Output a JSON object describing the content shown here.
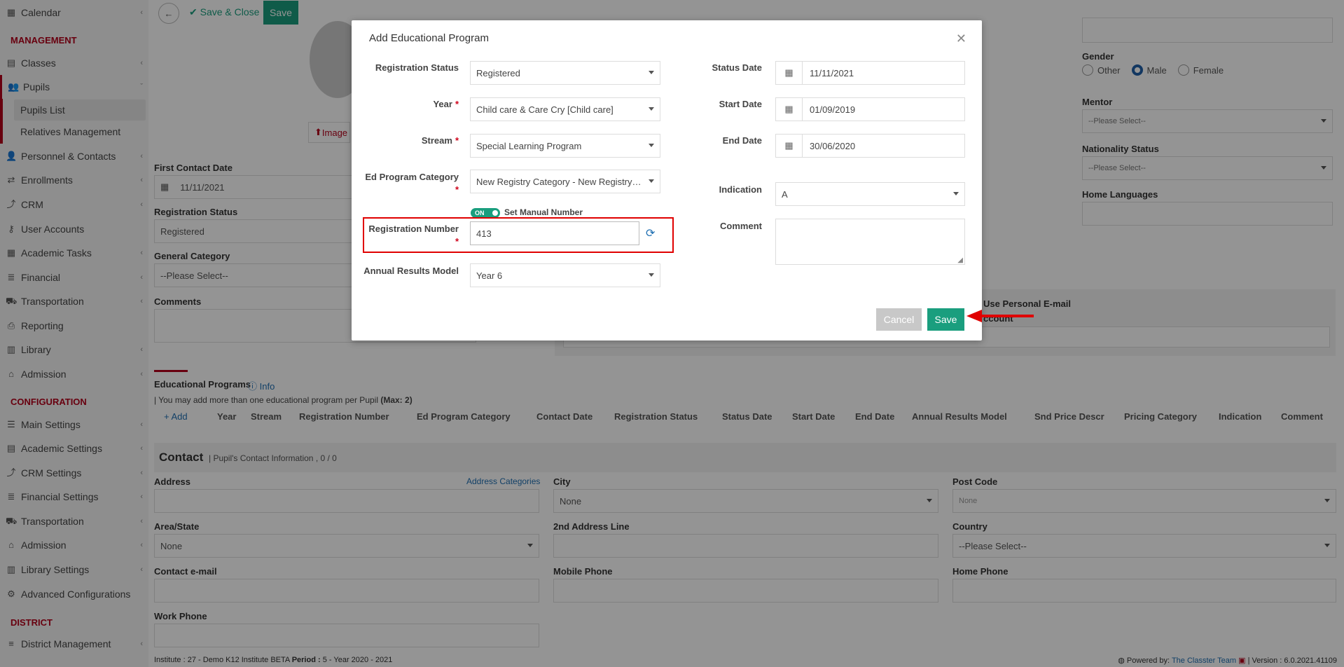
{
  "sidebar": {
    "items": [
      {
        "label": "Calendar",
        "icon": "calendar-icon"
      },
      {
        "label": "Classes",
        "icon": "classes-icon"
      },
      {
        "label": "Pupils",
        "icon": "pupils-icon"
      },
      {
        "label": "Personnel & Contacts",
        "icon": "personnel-icon"
      },
      {
        "label": "Enrollments",
        "icon": "enrollments-icon"
      },
      {
        "label": "CRM",
        "icon": "crm-icon"
      },
      {
        "label": "User Accounts",
        "icon": "key-icon"
      },
      {
        "label": "Academic Tasks",
        "icon": "tasks-icon"
      },
      {
        "label": "Financial",
        "icon": "financial-icon"
      },
      {
        "label": "Transportation",
        "icon": "bus-icon"
      },
      {
        "label": "Reporting",
        "icon": "print-icon"
      },
      {
        "label": "Library",
        "icon": "library-icon"
      },
      {
        "label": "Admission",
        "icon": "admission-icon"
      },
      {
        "label": "Main Settings",
        "icon": "sliders-icon"
      },
      {
        "label": "Academic Settings",
        "icon": "classes-icon"
      },
      {
        "label": "CRM Settings",
        "icon": "crm-icon"
      },
      {
        "label": "Financial Settings",
        "icon": "financial-icon"
      },
      {
        "label": "Transportation",
        "icon": "bus-icon"
      },
      {
        "label": "Admission",
        "icon": "admission-icon"
      },
      {
        "label": "Library Settings",
        "icon": "library-icon"
      },
      {
        "label": "Advanced Configurations",
        "icon": "gears-icon"
      },
      {
        "label": "District Management",
        "icon": "menu-icon"
      }
    ],
    "sections": {
      "management": "MANAGEMENT",
      "configuration": "CONFIGURATION",
      "district": "DISTRICT"
    },
    "subitems": {
      "pupils_list": "Pupils List",
      "relatives": "Relatives Management"
    }
  },
  "toolbar": {
    "save_close": "Save & Close",
    "save": "Save"
  },
  "form": {
    "image_btn": "Image",
    "first_contact_label": "First Contact Date",
    "first_contact_value": "11/11/2021",
    "reg_status_label": "Registration Status",
    "reg_status_value": "Registered",
    "general_category_label": "General Category",
    "general_category_value": "--Please Select--",
    "comments_label": "Comments",
    "gender_label": "Gender",
    "gender_options": [
      "Other",
      "Male",
      "Female"
    ],
    "gender_selected": "Male",
    "mentor_label": "Mentor",
    "mentor_value": "--Please Select--",
    "nationality_label": "Nationality Status",
    "nationality_value": "--Please Select--",
    "home_lang_label": "Home Languages",
    "personal_email_label": "Use Personal E-mail",
    "personal_email_label2": "ccount"
  },
  "edu": {
    "title": "Educational Programs",
    "info": "Info",
    "note": "| You may add more than one educational program per Pupil",
    "max": "(Max: 2)",
    "add": "+ Add",
    "columns": [
      "Year",
      "Stream",
      "Registration Number",
      "Ed Program Category",
      "Contact Date",
      "Registration Status",
      "Status Date",
      "Start Date",
      "End Date",
      "Annual Results Model",
      "Snd Price Descr",
      "Pricing Category",
      "Indication",
      "Comment"
    ]
  },
  "contact": {
    "title": "Contact",
    "subtitle": "| Pupil's Contact Information , 0 / 0",
    "address": "Address",
    "address_categories": "Address Categories",
    "city": "City",
    "city_value": "None",
    "post_code": "Post Code",
    "post_code_value": "None",
    "area": "Area/State",
    "area_value": "None",
    "address2": "2nd Address Line",
    "country": "Country",
    "country_value": "--Please Select--",
    "email": "Contact e-mail",
    "mobile": "Mobile Phone",
    "home_phone": "Home Phone",
    "work_phone": "Work Phone"
  },
  "footer": {
    "institute_label": "Institute :",
    "institute_value": "27 - Demo K12 Institute BETA",
    "period_label": "Period :",
    "period_value": "5 - Year 2020 - 2021",
    "powered": "Powered by:",
    "team": "The Classter Team",
    "version": "| Version : 6.0.2021.41109"
  },
  "modal": {
    "title": "Add Educational Program",
    "reg_status_label": "Registration Status",
    "reg_status_value": "Registered",
    "year_label": "Year",
    "year_value": "Child care & Care Cry [Child care]",
    "stream_label": "Stream",
    "stream_value": "Special Learning Program",
    "category_label": "Ed Program Category",
    "category_value": "New Registry Category - New Registry Cat...",
    "toggle_label": "ON",
    "manual_number_label": "Set Manual Number",
    "reg_number_label": "Registration Number",
    "reg_number_value": "413",
    "annual_label": "Annual Results Model",
    "annual_value": "Year 6",
    "status_date_label": "Status Date",
    "status_date_value": "11/11/2021",
    "start_date_label": "Start Date",
    "start_date_value": "01/09/2019",
    "end_date_label": "End Date",
    "end_date_value": "30/06/2020",
    "indication_label": "Indication",
    "indication_value": "A",
    "comment_label": "Comment",
    "required_mark": "*",
    "cancel": "Cancel",
    "save": "Save"
  },
  "colors": {
    "accent": "#1a9e7e",
    "brand_red": "#b3001b",
    "highlight": "#e00000"
  }
}
